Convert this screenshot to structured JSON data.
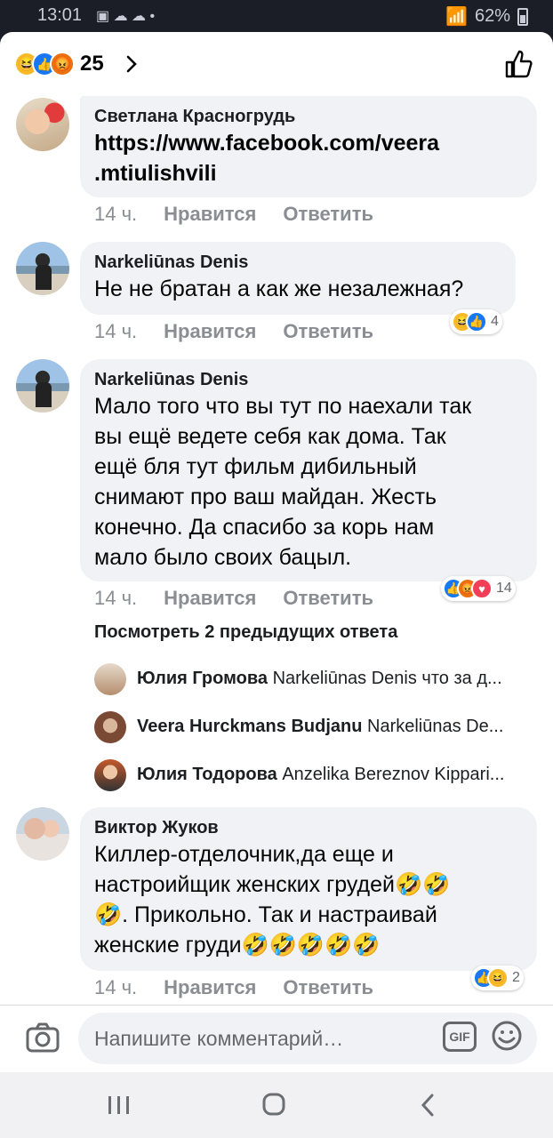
{
  "status": {
    "time": "13:01",
    "battery": "62%"
  },
  "topbar": {
    "reaction_count": "25"
  },
  "comments": [
    {
      "name": "Светлана Красногрудь",
      "text_lines": [
        "https://www.facebook.com/veera",
        ".mtiulishvili"
      ],
      "time": "14 ч.",
      "like": "Нравится",
      "reply": "Ответить"
    },
    {
      "name": "Narkeliūnas Denis",
      "text_lines": [
        "Не не братан а как же незалежная?"
      ],
      "time": "14 ч.",
      "like": "Нравится",
      "reply": "Ответить",
      "reactions_count": "4"
    },
    {
      "name": "Narkeliūnas Denis",
      "text_lines": [
        "Мало того что вы тут по наехали так",
        "вы ещё ведете себя как дома. Так",
        "ещё бля тут фильм дибильный",
        "снимают про ваш майдан. Жесть",
        "конечно. Да спасибо за корь нам",
        "мало было своих бацыл."
      ],
      "time": "14 ч.",
      "like": "Нравится",
      "reply": "Ответить",
      "reactions_count": "14"
    },
    {
      "name": "Виктор Жуков",
      "text_lines": [
        "Киллер-отделочник,да еще и",
        "настроийщик женских грудей🤣🤣",
        "🤣. Прикольно. Так и настраивай",
        "женские груди🤣🤣🤣🤣🤣"
      ],
      "time": "14 ч.",
      "like": "Нравится",
      "reply": "Ответить",
      "reactions_count": "2"
    }
  ],
  "view_more": "Посмотреть 2 предыдущих ответа",
  "replies": [
    {
      "name": "Юлия Громова",
      "text": "Narkeliūnas Denis что за д..."
    },
    {
      "name": "Veera Hurckmans Budjanu",
      "text": "Narkeliūnas De..."
    },
    {
      "name": "Юлия Тодорова",
      "text": "Anzelika Bereznov Kippari..."
    }
  ],
  "composer": {
    "placeholder": "Напишите комментарий…",
    "gif_label": "GIF"
  }
}
